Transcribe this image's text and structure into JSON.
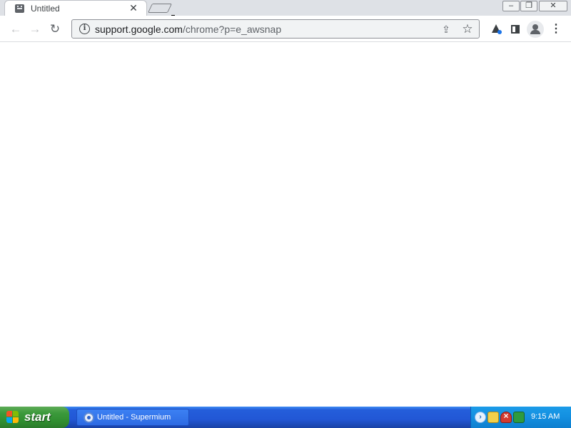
{
  "browser": {
    "tab": {
      "title": "Untitled",
      "close_glyph": "✕",
      "favicon": "sad-page-icon"
    },
    "window_controls": {
      "minimize_glyph": "–",
      "restore_glyph": "❐",
      "close_glyph": "✕"
    },
    "toolbar": {
      "back_glyph": "←",
      "forward_glyph": "→",
      "reload_glyph": "↻",
      "menu_glyph": "⋮"
    },
    "omnibox": {
      "info_glyph": "i",
      "url_host": "support.google.com",
      "url_path": "/chrome?p=e_awsnap",
      "share_glyph": "⇪",
      "star_glyph": "☆"
    }
  },
  "taskbar": {
    "start_label": "start",
    "tasks": [
      {
        "label": "Untitled - Supermium",
        "icon": "supermium-icon"
      }
    ],
    "tray": {
      "arrow_glyph": "›",
      "clock": "9:15 AM"
    }
  }
}
